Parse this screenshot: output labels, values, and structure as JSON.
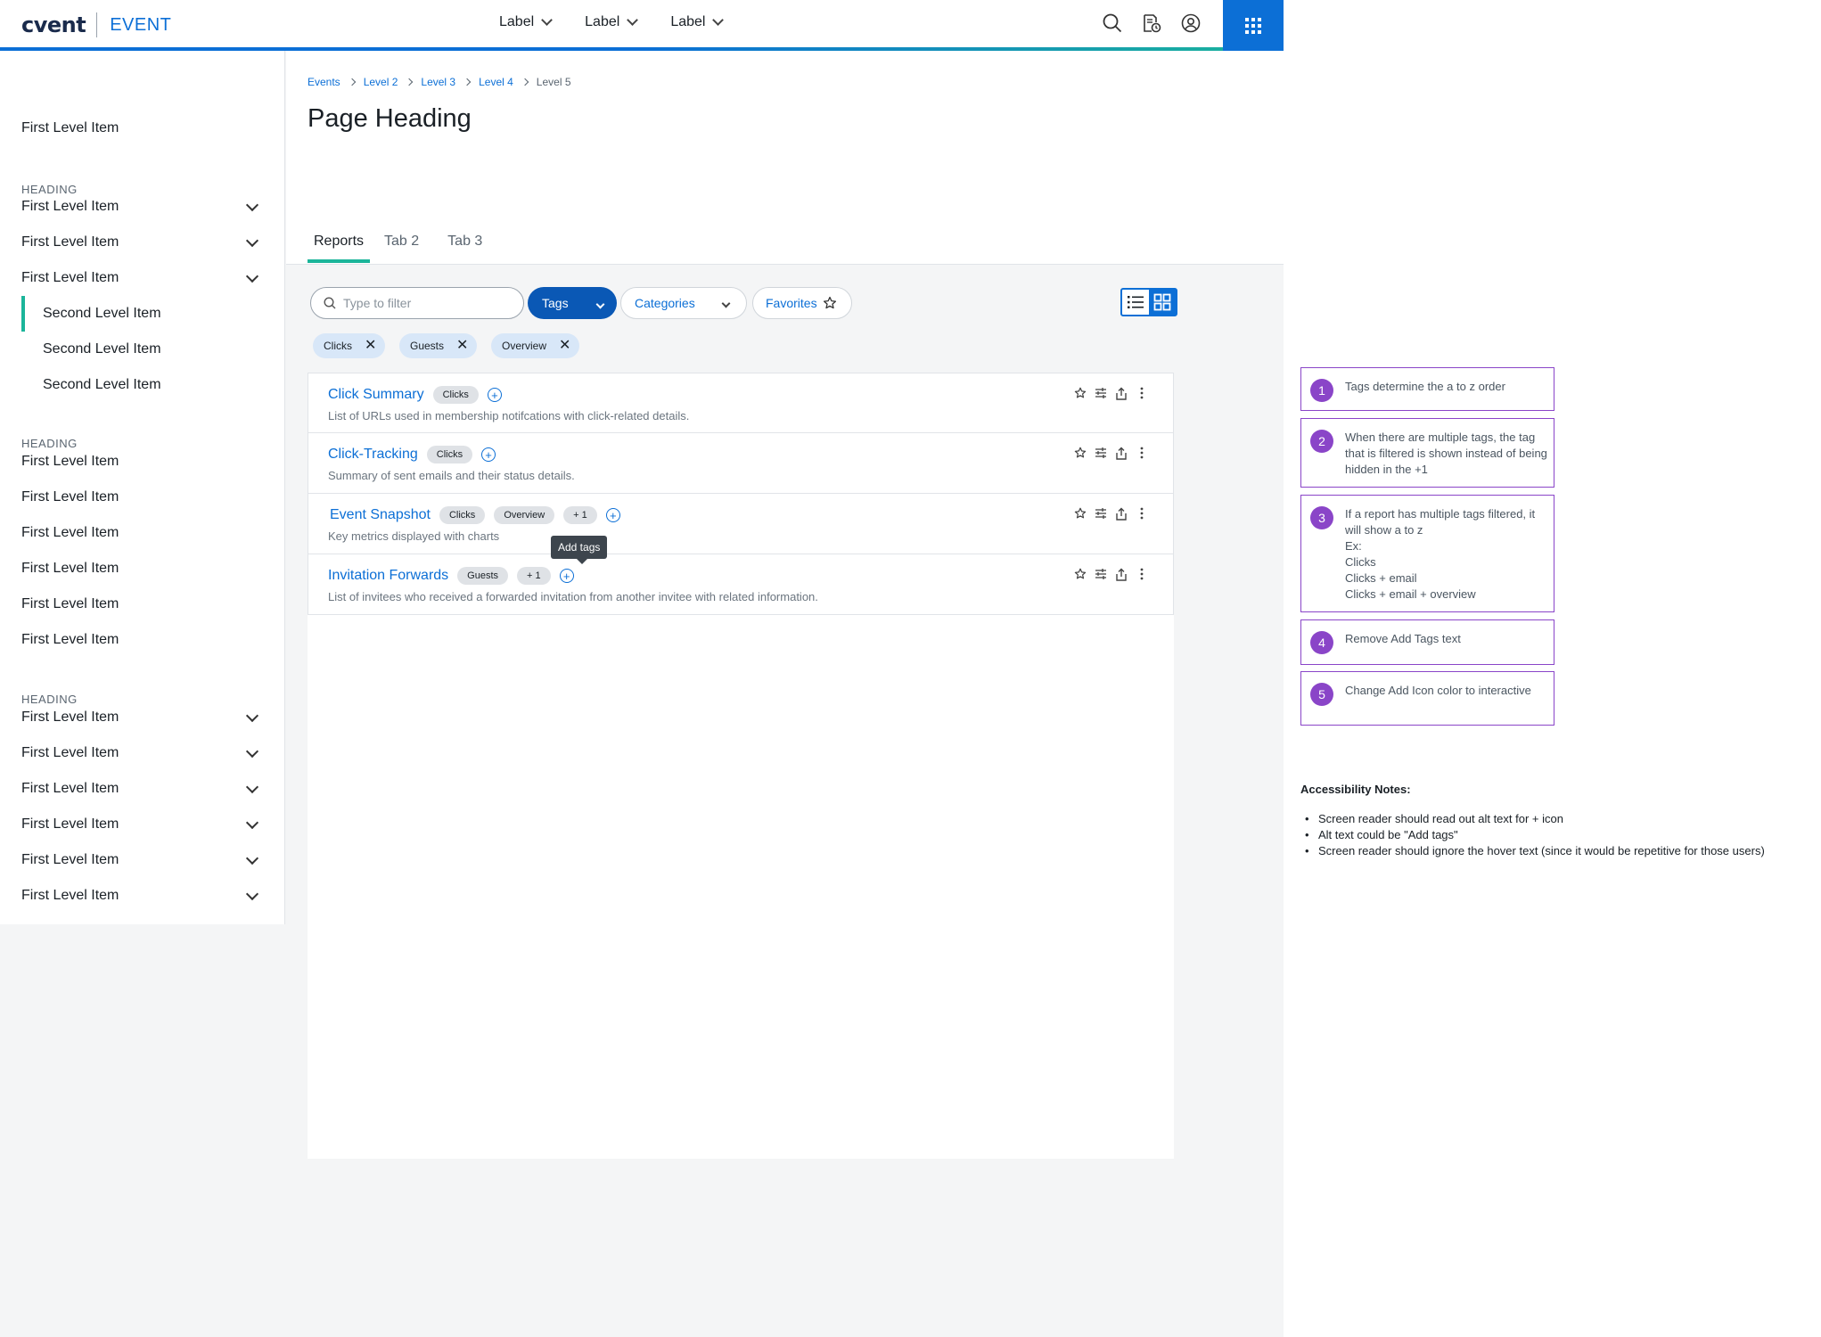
{
  "header": {
    "logo": "cvent",
    "product": "EVENT",
    "nav": [
      {
        "label": "Label"
      },
      {
        "label": "Label"
      },
      {
        "label": "Label"
      }
    ],
    "icons": [
      "search-icon",
      "document-clock-icon",
      "user-account-icon",
      "apps-grid-icon"
    ]
  },
  "sidebar": {
    "item_1": "First Level Item",
    "heading_1": "HEADING",
    "group_1": [
      "First Level Item",
      "First Level Item",
      "First Level Item"
    ],
    "second_level": [
      "Second Level Item",
      "Second Level Item",
      "Second Level Item"
    ],
    "heading_2": "HEADING",
    "group_2": [
      "First Level Item",
      "First Level Item",
      "First Level Item",
      "First Level Item",
      "First Level Item",
      "First Level Item"
    ],
    "heading_3": "HEADING",
    "group_3": [
      "First Level Item",
      "First Level Item",
      "First Level Item",
      "First Level Item",
      "First Level Item",
      "First Level Item"
    ]
  },
  "breadcrumb": [
    "Events",
    "Level 2",
    "Level 3",
    "Level 4",
    "Level 5"
  ],
  "page": {
    "title": "Page Heading"
  },
  "tabs": [
    {
      "label": "Reports"
    },
    {
      "label": "Tab 2"
    },
    {
      "label": "Tab 3"
    }
  ],
  "filters": {
    "search_placeholder": "Type to filter",
    "tags_label": "Tags",
    "categories_label": "Categories",
    "favorites_label": "Favorites",
    "chips": [
      "Clicks",
      "Guests",
      "Overview"
    ]
  },
  "reports": [
    {
      "name": "Click Summary",
      "tags": [
        "Clicks"
      ],
      "desc": "List of URLs used in membership notifcations with click-related details."
    },
    {
      "name": "Click-Tracking",
      "tags": [
        "Clicks"
      ],
      "desc": "Summary of sent emails and their status details."
    },
    {
      "name": "Event Snapshot",
      "tags": [
        "Clicks",
        "Overview",
        "+ 1"
      ],
      "desc": "Key metrics displayed with charts"
    },
    {
      "name": "Invitation Forwards",
      "tags": [
        "Guests",
        "+ 1"
      ],
      "desc": "List of invitees who received a forwarded invitation from another invitee with related information."
    }
  ],
  "tooltip": "Add tags",
  "notes": [
    {
      "num": "1",
      "text": "Tags determine the a to z order"
    },
    {
      "num": "2",
      "text": "When there are multiple tags, the tag that is filtered is shown instead of being hidden in the +1"
    },
    {
      "num": "3",
      "text": "If a report has multiple tags filtered, it will show  a to z\nEx:\nClicks\nClicks + email\nClicks + email + overview"
    },
    {
      "num": "4",
      "text": "Remove Add Tags text"
    },
    {
      "num": "5",
      "text": "Change Add Icon color to interactive"
    }
  ],
  "accessibility": {
    "title": "Accessibility Notes:",
    "items": [
      "Screen reader should read out alt text for + icon",
      "Alt text could be \"Add tags\"",
      "Screen reader should ignore the hover text (since it would be repetitive for those users)"
    ]
  },
  "colors": {
    "primary": "#0c6fd6",
    "accent": "#1bb59a",
    "note_purple": "#8a45c8",
    "chip_bg": "#d8e7f8"
  }
}
